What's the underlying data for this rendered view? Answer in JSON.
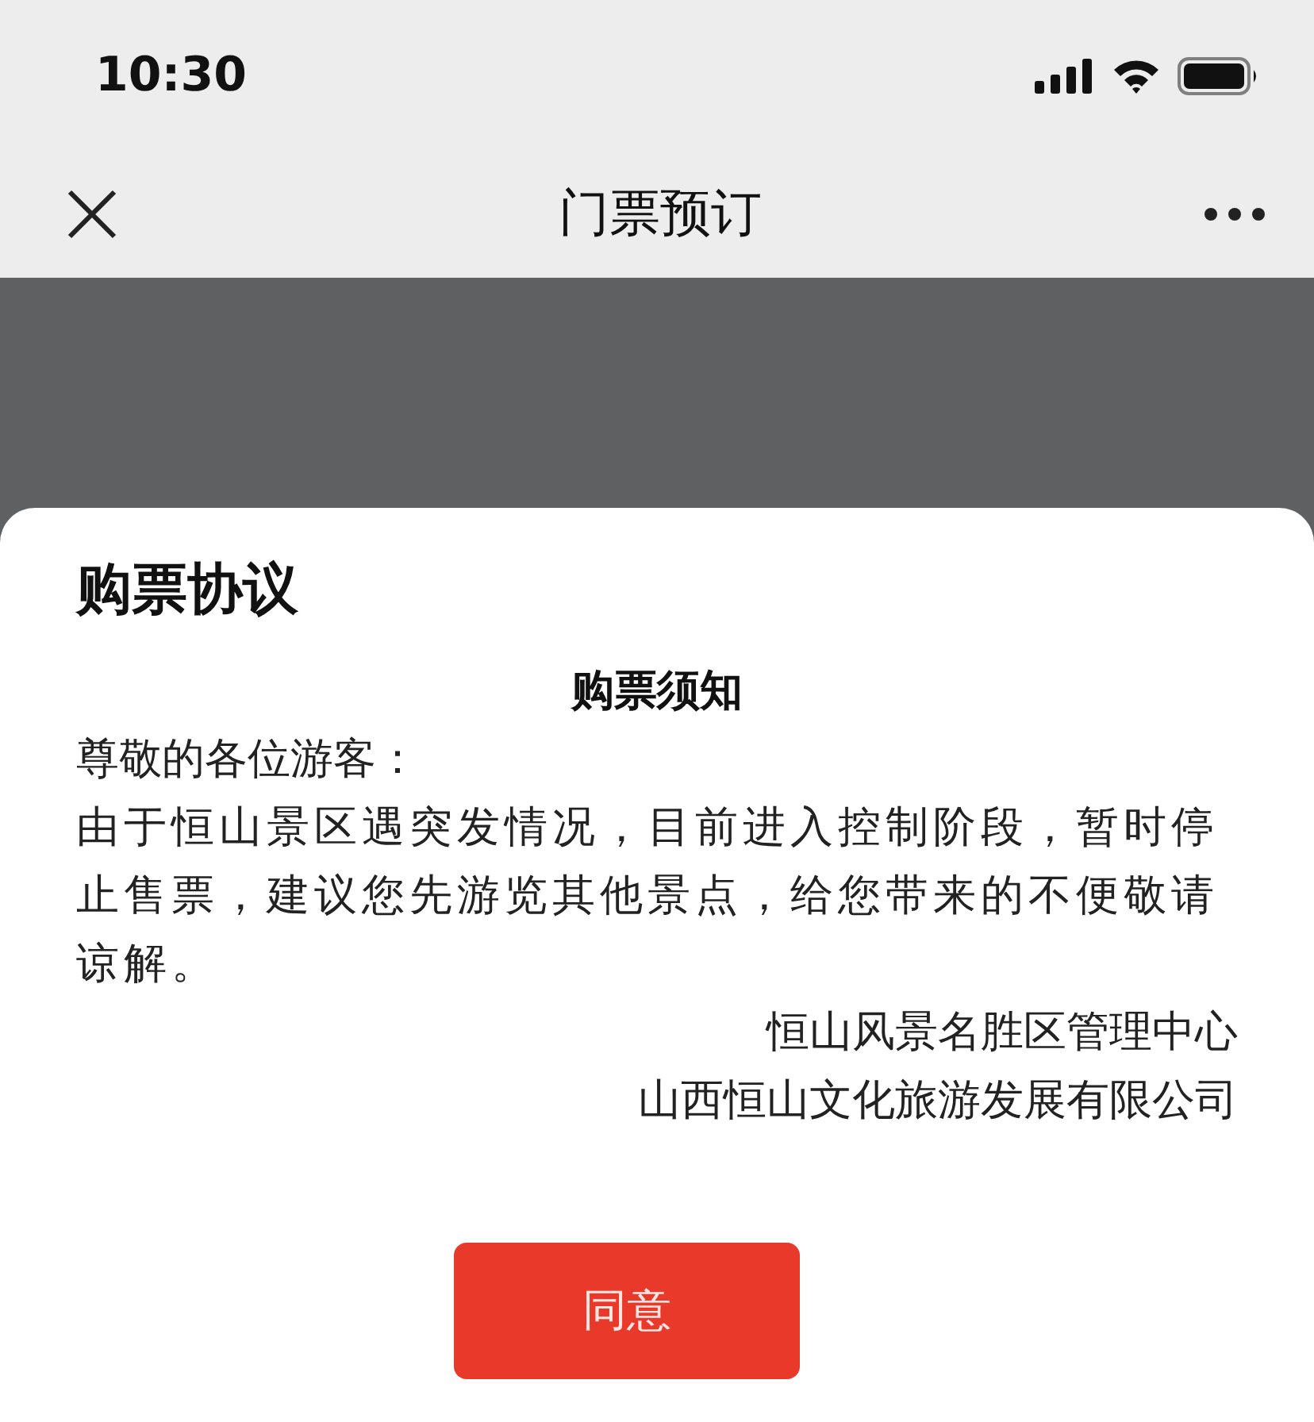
{
  "status_bar": {
    "time": "10:30"
  },
  "nav_bar": {
    "title": "门票预订"
  },
  "dialog": {
    "title": "购票协议",
    "heading": "购票须知",
    "greeting": "尊敬的各位游客：",
    "body": "由于恒山景区遇突发情况，目前进入控制阶段，暂时停止售票，建议您先游览其他景点，给您带来的不便敬请谅解。",
    "signatures": [
      "恒山风景名胜区管理中心",
      "山西恒山文化旅游发展有限公司"
    ],
    "button": "同意"
  }
}
